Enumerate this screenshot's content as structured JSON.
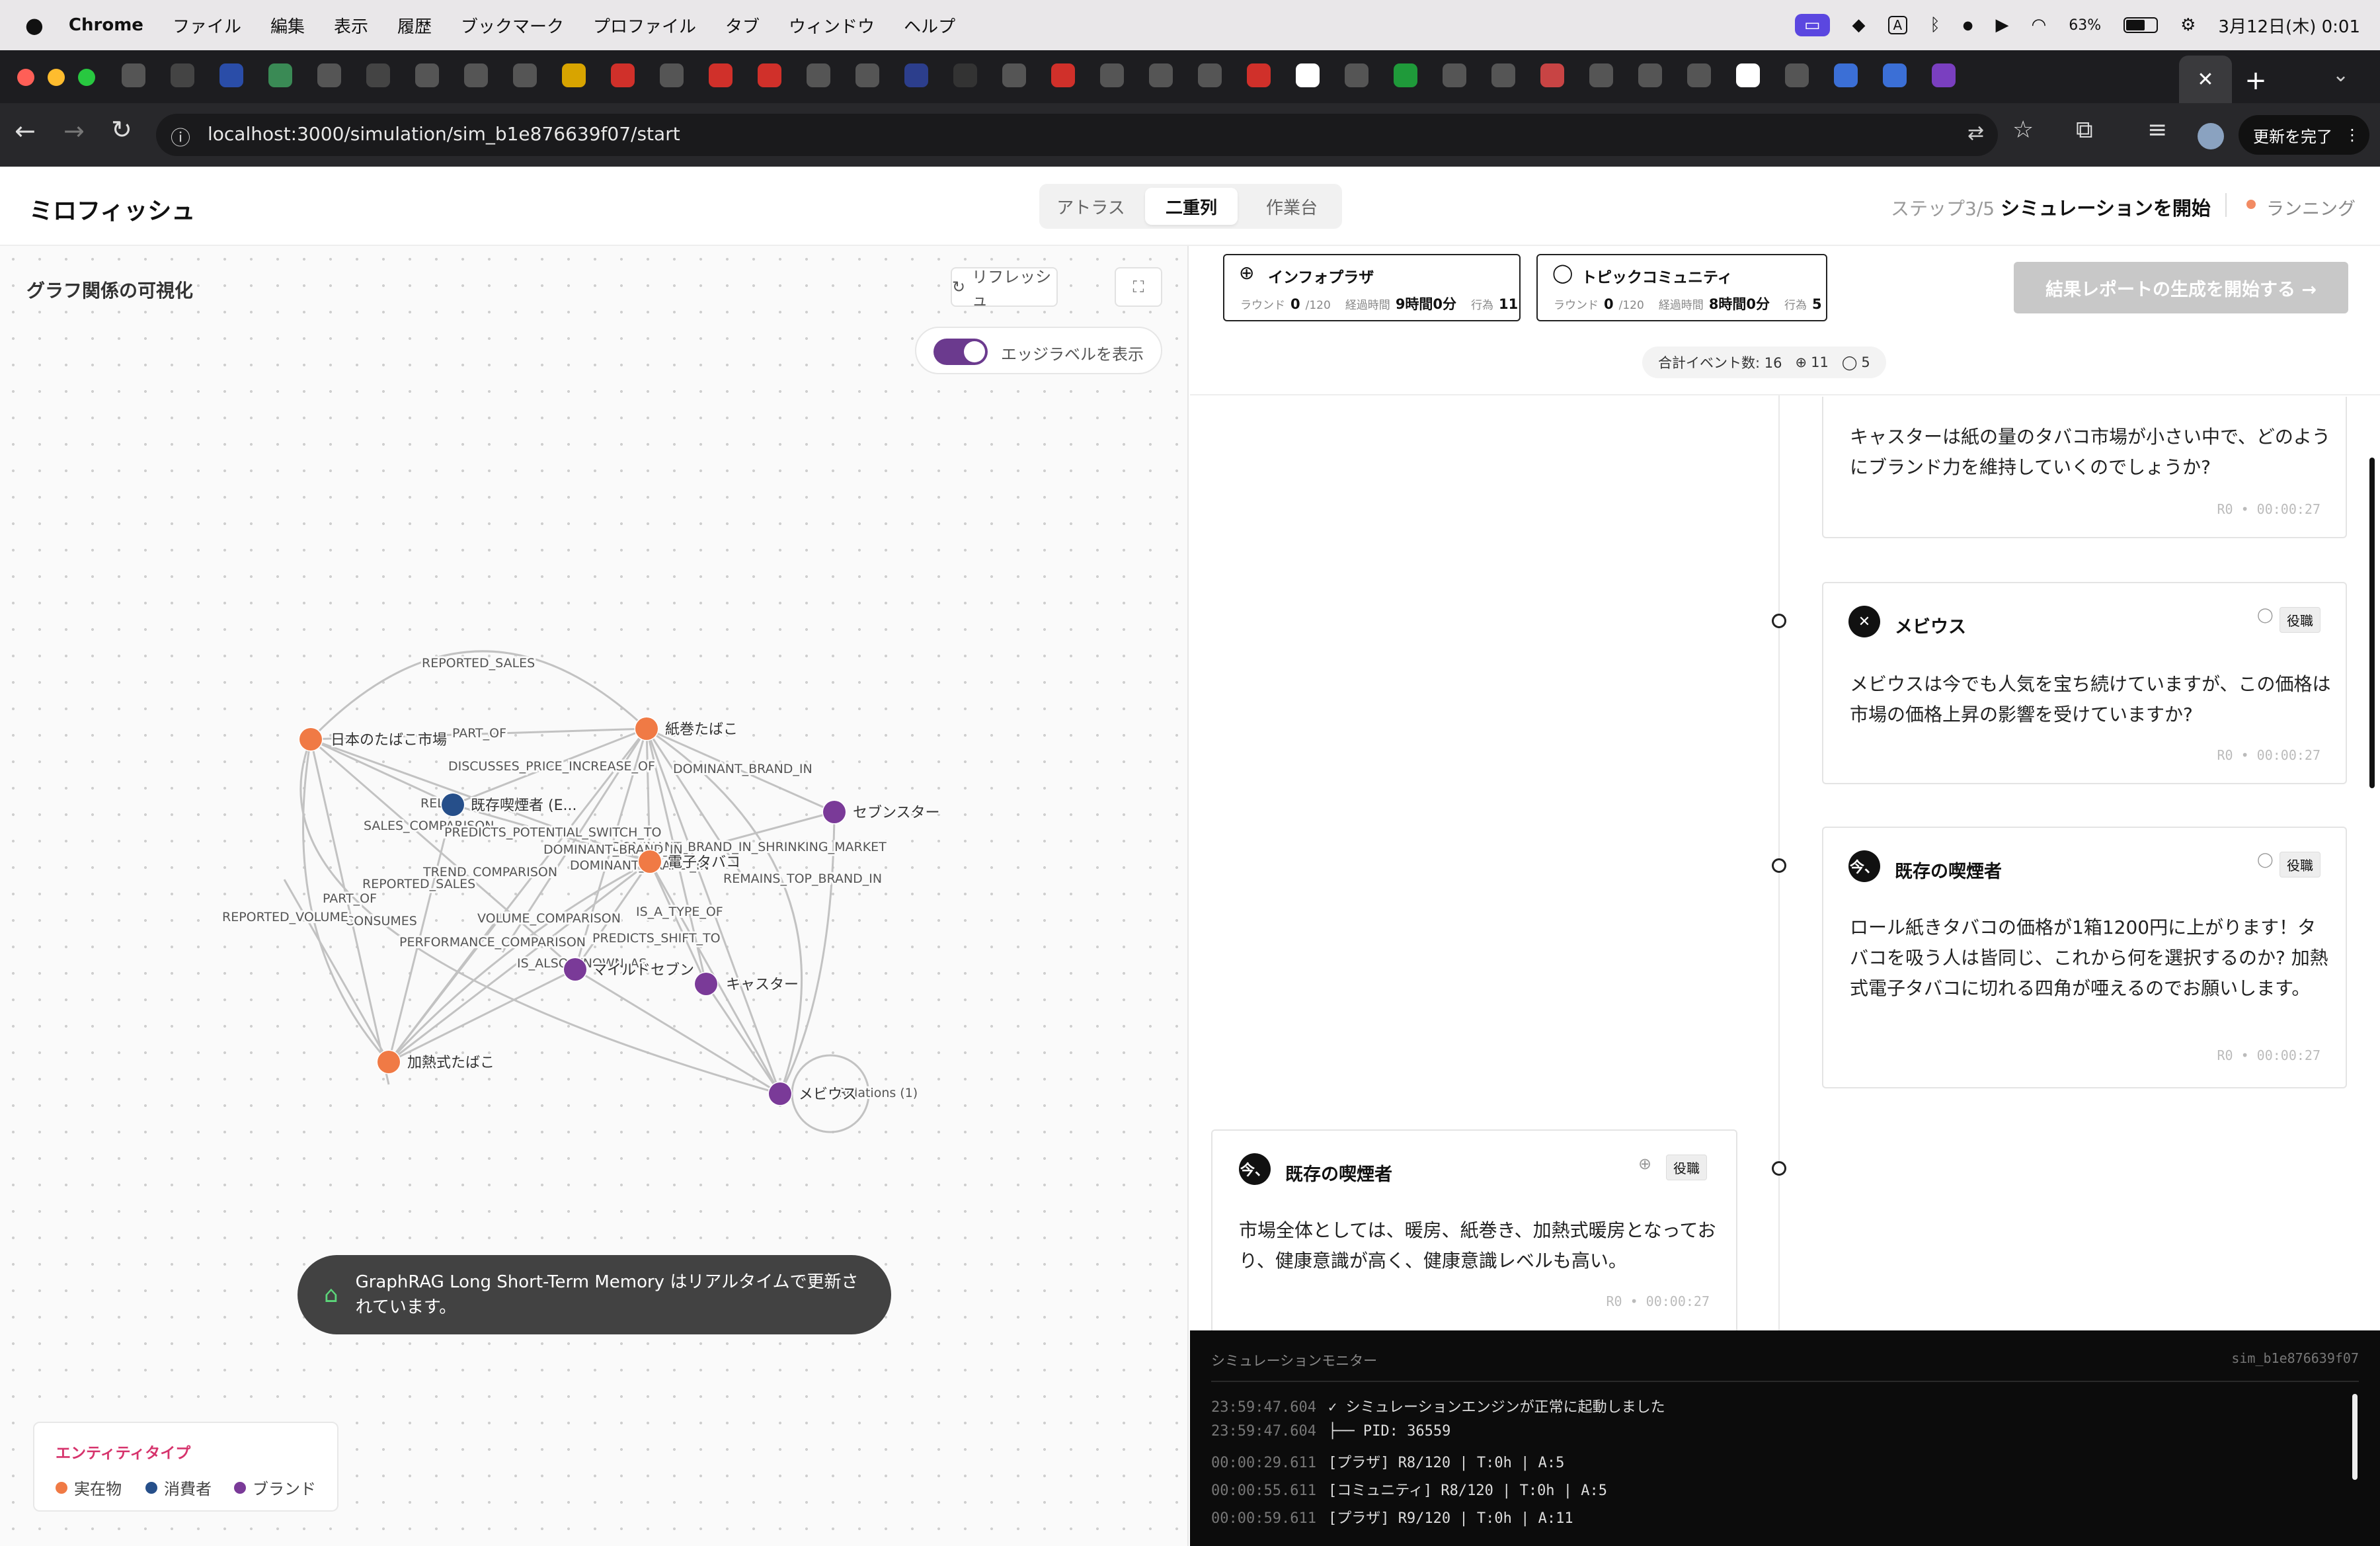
{
  "menubar": {
    "app": "Chrome",
    "items": [
      "ファイル",
      "編集",
      "表示",
      "履歴",
      "ブックマーク",
      "プロファイル",
      "タブ",
      "ウィンドウ",
      "ヘルプ"
    ],
    "battery": "63%",
    "datetime": "3月12日(木)  0:01"
  },
  "browser": {
    "url": "localhost:3000/simulation/sim_b1e876639f07/start",
    "update_label": "更新を完了"
  },
  "app": {
    "brand": "ミロフィッシュ",
    "modes": [
      "アトラス",
      "二重列",
      "作業台"
    ],
    "step": "ステップ3/5",
    "step_title": "シミュレーションを開始",
    "status": "ランニング"
  },
  "graph": {
    "title": "グラフ関係の可視化",
    "refresh_label": "リフレッシュ",
    "edge_toggle_label": "エッジラベルを表示",
    "toast": "GraphRAG Long Short-Term Memory はリアルタイムで更新されています。",
    "nodes": [
      {
        "label": "日本のたばこ市場",
        "kind": "entity"
      },
      {
        "label": "紙巻たばこ",
        "kind": "entity"
      },
      {
        "label": "既存喫煙者 (E...",
        "kind": "consumer"
      },
      {
        "label": "セブンスター",
        "kind": "brand"
      },
      {
        "label": "電子タバコ",
        "kind": "entity"
      },
      {
        "label": "マイルドセブン",
        "kind": "brand"
      },
      {
        "label": "キャスター",
        "kind": "brand"
      },
      {
        "label": "加熱式たばこ",
        "kind": "entity"
      },
      {
        "label": "メビウス",
        "kind": "brand"
      }
    ],
    "self_loop_label": "Relations (1)",
    "edge_labels": [
      "REPORTED_SALES",
      "PART_OF",
      "DISCUSSES_PRICE_INCREASE_OF",
      "DOMINANT_BRAND_IN",
      "REL",
      "SALES_COMPARISON",
      "PREDICTS_POTENTIAL_SWITCH_TO",
      "DOMINANT_BRAND_IN_SHRINKING_MARKET",
      "DOMINANT_BRAND_IN",
      "TREND_COMPARISON",
      "DOMINANT_BRAND_IN",
      "REPORTED_SALES",
      "PART_OF",
      "CONSUMES",
      "REPORTED_VOLUME",
      "VOLUME_COMPARISON",
      "REMAINS_TOP_BRAND_IN",
      "IS_A_TYPE_OF",
      "PREDICTS_SHIFT_TO",
      "PERFORMANCE_COMPARISON",
      "IS_ALSO_KNOWN_AS"
    ],
    "legend": {
      "title": "エンティティタイプ",
      "items": [
        {
          "label": "実在物",
          "color": "#f07a45"
        },
        {
          "label": "消費者",
          "color": "#264f8a"
        },
        {
          "label": "ブランド",
          "color": "#7a3a98"
        }
      ]
    }
  },
  "platforms": [
    {
      "name": "インフォプラザ",
      "round_label": "ラウンド",
      "round": "0",
      "round_total": "/120",
      "elapsed_label": "経過時間",
      "elapsed": "9時間0分",
      "acts_label": "行為",
      "acts": "11"
    },
    {
      "name": "トピックコミュニティ",
      "round_label": "ラウンド",
      "round": "0",
      "round_total": "/120",
      "elapsed_label": "経過時間",
      "elapsed": "8時間0分",
      "acts_label": "行為",
      "acts": "5"
    }
  ],
  "report_button": "結果レポートの生成を開始する →",
  "events_summary": {
    "label": "合計イベント数: 16",
    "plaza": "11",
    "community": "5"
  },
  "timeline": [
    {
      "agent": "",
      "body": "キャスターは紙の量のタバコ市場が小さい中で、どのようにブランド力を維持していくのでしょうか?",
      "meta": "R0 • 00:00:27"
    },
    {
      "agent": "メビウス",
      "avatar": "✕",
      "badge": "役職",
      "body": "メビウスは今でも人気を宝ち続けていますが、この価格は市場の価格上昇の影響を受けていますか?",
      "meta": "R0 • 00:00:27"
    },
    {
      "agent": "既存の喫煙者",
      "avatar": "今、",
      "badge": "役職",
      "body": "ロール紙きタバコの価格が1箱1200円に上がります！タバコを吸う人は皆同じ、これから何を選択するのか? 加熱式電子タバコに切れる四角が唖えるのでお願いします。",
      "meta": "R0 • 00:00:27"
    },
    {
      "agent": "既存の喫煙者",
      "avatar": "今、",
      "badge": "役職",
      "body": "市場全体としては、暖房、紙巻き、加熱式暖房となっており、健康意識が高く、健康意識レベルも高い。",
      "meta": "R0 • 00:00:27"
    }
  ],
  "monitor": {
    "title": "シミュレーションモニター",
    "sim_id": "sim_b1e876639f07",
    "logs": [
      {
        "ts": "23:59:47.604",
        "msg": "✓ シミュレーションエンジンが正常に起動しました"
      },
      {
        "ts": "23:59:47.604",
        "msg": "├── PID: 36559"
      },
      {
        "ts": "00:00:29.611",
        "msg": "[プラザ] R8/120 | T:0h | A:5"
      },
      {
        "ts": "00:00:55.611",
        "msg": "[コミュニティ] R8/120 | T:0h | A:5"
      },
      {
        "ts": "00:00:59.611",
        "msg": "[プラザ] R9/120 | T:0h | A:11"
      }
    ]
  },
  "colors": {
    "entity": "#f07a45",
    "consumer": "#264f8a",
    "brand": "#7a3a98",
    "toggle": "#6b3a8e",
    "status_dot": "#f28b63"
  }
}
